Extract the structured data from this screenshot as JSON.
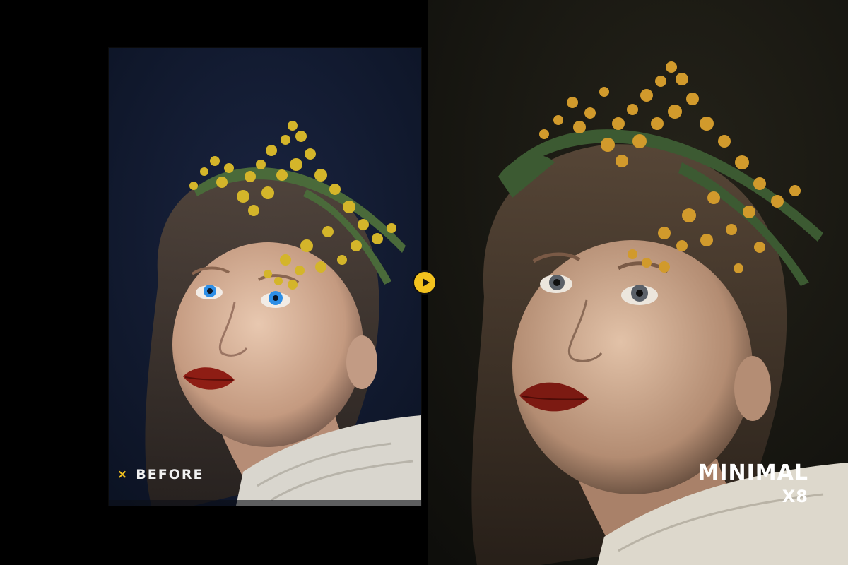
{
  "before": {
    "label": "BEFORE",
    "marker_icon": "x-mark-icon",
    "marker_glyph": "×"
  },
  "after": {
    "title_line1": "MINIMAL",
    "title_line2": "X8"
  },
  "compare_button": {
    "icon": "play-icon"
  },
  "colors": {
    "accent": "#f3c21e",
    "background": "#000000",
    "before_backdrop": "#121a2e",
    "after_backdrop": "#17160f"
  }
}
